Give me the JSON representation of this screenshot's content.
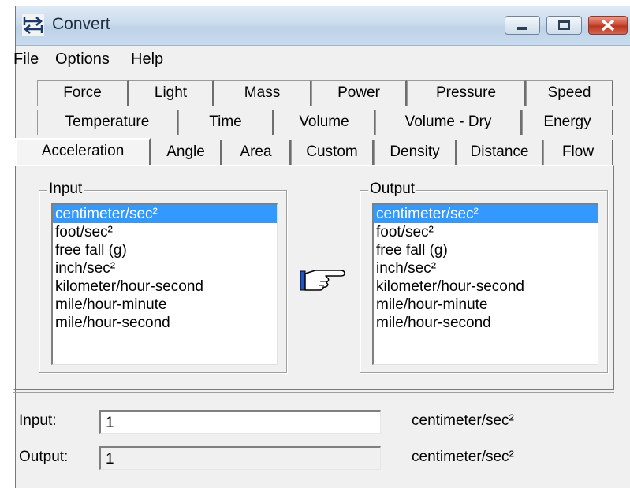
{
  "window": {
    "title": "Convert"
  },
  "menu": [
    "File",
    "Options",
    "Help"
  ],
  "tabs": {
    "row1": [
      "Force",
      "Light",
      "Mass",
      "Power",
      "Pressure",
      "Speed"
    ],
    "row2": [
      "Temperature",
      "Time",
      "Volume",
      "Volume - Dry",
      "Energy"
    ],
    "row3": [
      "Acceleration",
      "Angle",
      "Area",
      "Custom",
      "Density",
      "Distance",
      "Flow"
    ],
    "active": "Acceleration"
  },
  "input_group": {
    "title": "Input",
    "items": [
      "centimeter/sec²",
      "foot/sec²",
      "free fall (g)",
      "inch/sec²",
      "kilometer/hour-second",
      "mile/hour-minute",
      "mile/hour-second"
    ],
    "selected": "centimeter/sec²"
  },
  "output_group": {
    "title": "Output",
    "items": [
      "centimeter/sec²",
      "foot/sec²",
      "free fall (g)",
      "inch/sec²",
      "kilometer/hour-second",
      "mile/hour-minute",
      "mile/hour-second"
    ],
    "selected": "centimeter/sec²"
  },
  "input_row": {
    "label": "Input:",
    "value": "1",
    "unit": "centimeter/sec²"
  },
  "output_row": {
    "label": "Output:",
    "value": "1",
    "unit": "centimeter/sec²"
  },
  "icons": {
    "app": "convert-arrows-icon",
    "pointer": "pointing-hand-icon"
  },
  "colors": {
    "selection": "#3399ff",
    "close_button": "#c9452f",
    "titlebar": "#cbdced"
  }
}
